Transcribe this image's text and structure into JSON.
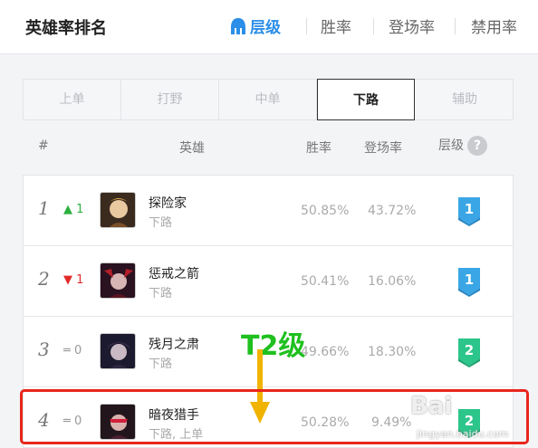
{
  "header": {
    "title": "英雄率排名",
    "tabs": [
      {
        "label": "层级",
        "active": true
      },
      {
        "label": "胜率",
        "active": false
      },
      {
        "label": "登场率",
        "active": false
      },
      {
        "label": "禁用率",
        "active": false
      }
    ]
  },
  "position_tabs": [
    {
      "label": "上单",
      "active": false
    },
    {
      "label": "打野",
      "active": false
    },
    {
      "label": "中单",
      "active": false
    },
    {
      "label": "下路",
      "active": true
    },
    {
      "label": "辅助",
      "active": false
    }
  ],
  "columns": {
    "rank": "#",
    "hero": "英雄",
    "winrate": "胜率",
    "pickrate": "登场率",
    "tier": "层级",
    "tier_help": "?"
  },
  "rows": [
    {
      "rank": "1",
      "change_dir": "up",
      "change": "1",
      "name": "探险家",
      "position": "下路",
      "winrate": "50.85%",
      "pickrate": "43.72%",
      "tier": "1",
      "tier_color": "#3aa6e6"
    },
    {
      "rank": "2",
      "change_dir": "down",
      "change": "1",
      "name": "惩戒之箭",
      "position": "下路",
      "winrate": "50.41%",
      "pickrate": "16.06%",
      "tier": "1",
      "tier_color": "#3aa6e6"
    },
    {
      "rank": "3",
      "change_dir": "same",
      "change": "0",
      "name": "残月之肃",
      "position": "下路",
      "winrate": "49.66%",
      "pickrate": "18.30%",
      "tier": "2",
      "tier_color": "#2cc58a"
    },
    {
      "rank": "4",
      "change_dir": "same",
      "change": "0",
      "name": "暗夜猎手",
      "position": "下路, 上单",
      "winrate": "50.28%",
      "pickrate": "9.49%",
      "tier": "2",
      "tier_color": "#2cc58a"
    }
  ],
  "annotation": {
    "text": "T2级",
    "color": "#1fc01f",
    "arrow_color": "#f0b400",
    "box_color": "#e8261d"
  },
  "watermark": {
    "text": "Bai",
    "sub": "jingyan.baidu.com"
  }
}
